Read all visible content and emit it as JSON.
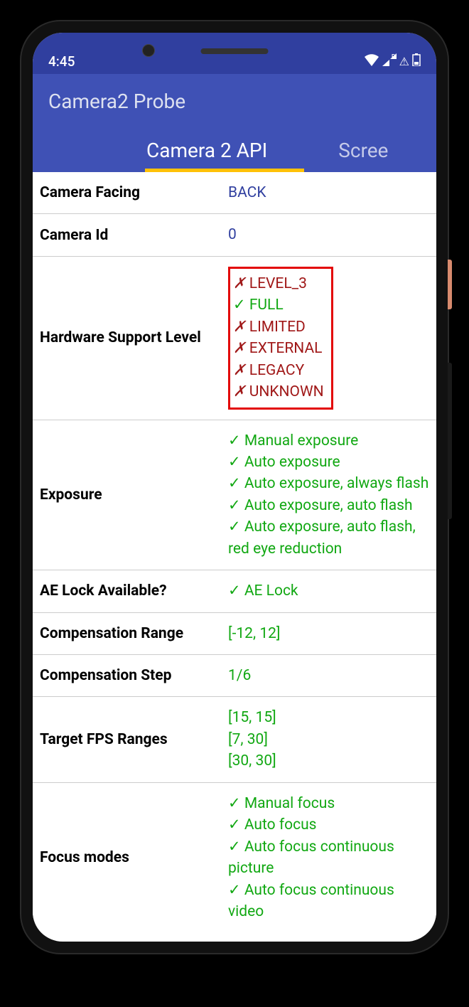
{
  "status": {
    "time": "4:45",
    "wifi": "wifi",
    "signal_r": "R",
    "battery": "battery"
  },
  "app": {
    "title": "Camera2 Probe"
  },
  "tabs": {
    "active": "Camera 2 API",
    "next": "Scree"
  },
  "rows": {
    "camera_facing": {
      "label": "Camera Facing",
      "value": "BACK"
    },
    "camera_id": {
      "label": "Camera Id",
      "value": "0"
    },
    "hw_support": {
      "label": "Hardware Support Level",
      "items": [
        {
          "text": "LEVEL_3",
          "ok": false
        },
        {
          "text": "FULL",
          "ok": true
        },
        {
          "text": "LIMITED",
          "ok": false
        },
        {
          "text": "EXTERNAL",
          "ok": false
        },
        {
          "text": "LEGACY",
          "ok": false
        },
        {
          "text": "UNKNOWN",
          "ok": false
        }
      ]
    },
    "exposure": {
      "label": "Exposure",
      "items": [
        "Manual exposure",
        "Auto exposure",
        "Auto exposure, always flash",
        "Auto exposure, auto flash",
        "Auto exposure, auto flash, red eye reduction"
      ]
    },
    "ae_lock": {
      "label": "AE Lock Available?",
      "value": "AE Lock"
    },
    "comp_range": {
      "label": "Compensation Range",
      "value": "[-12, 12]"
    },
    "comp_step": {
      "label": "Compensation Step",
      "value": "1/6"
    },
    "fps": {
      "label": "Target FPS Ranges",
      "items": [
        "[15, 15]",
        "[7, 30]",
        "[30, 30]"
      ]
    },
    "focus": {
      "label": "Focus modes",
      "items": [
        "Manual focus",
        "Auto focus",
        "Auto focus continuous picture",
        "Auto focus continuous video"
      ]
    }
  }
}
